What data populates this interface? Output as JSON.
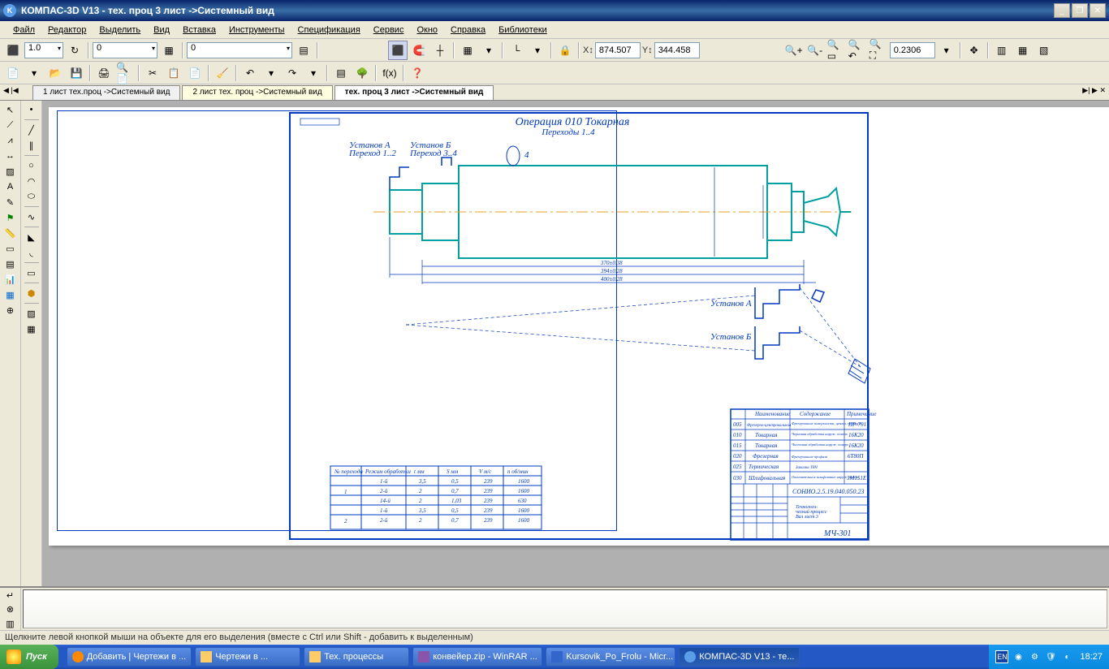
{
  "app": {
    "title": "КОМПАС-3D V13 - тех. проц 3 лист ->Системный вид"
  },
  "menu": {
    "file": "Файл",
    "edit": "Редактор",
    "select": "Выделить",
    "view": "Вид",
    "insert": "Вставка",
    "tools": "Инструменты",
    "spec": "Спецификация",
    "service": "Сервис",
    "window": "Окно",
    "help": "Справка",
    "lib": "Библиотеки"
  },
  "toolbar1": {
    "combo1": "1.0",
    "combo2": "0",
    "combo3": "0",
    "x": "874.507",
    "y": "344.458",
    "zoom": "0.2306"
  },
  "tabs": {
    "t1": "1 лист тех.проц ->Системный вид",
    "t2": "2 лист тех. проц ->Системный вид",
    "t3": "тех. проц 3 лист ->Системный вид"
  },
  "drawing": {
    "title": "Операция 010 Токарная",
    "subtitle": "Переходы 1..4",
    "ustanov_a": "Установ А",
    "perehod12": "Переход 1..2",
    "ustanov_b": "Установ Б",
    "perehod34": "Переход 3..4",
    "ustanov_a2": "Установ А",
    "ustanov_b2": "Установ Б",
    "dim4": "4"
  },
  "table": {
    "headers": [
      "№ перехода",
      "Режим обработки",
      "t мм",
      "S мм",
      "V м/с",
      "n об/мин"
    ],
    "rows": [
      [
        "",
        "1-й",
        "3,5",
        "0,5",
        "239",
        "1600"
      ],
      [
        "1",
        "2-й",
        "2",
        "0,7",
        "239",
        "1600"
      ],
      [
        "",
        "14-й",
        "2",
        "1,03",
        "239",
        "630"
      ],
      [
        "2",
        "1-й",
        "3,5",
        "0,5",
        "239",
        "1600"
      ],
      [
        "",
        "2-й",
        "2",
        "0,7",
        "239",
        "1600"
      ]
    ]
  },
  "stamp": {
    "cols": [
      "Наименование",
      "Содержание",
      "Примечание"
    ],
    "rows": [
      [
        "005",
        "Фрезерно-центровальная",
        "Фрезерование поверхности, центр. отверст.",
        "ПР-791"
      ],
      [
        "010",
        "Токарная",
        "Черновая обработка наруж. поверх",
        "16К20"
      ],
      [
        "015",
        "Токарная",
        "Чистовая обработка наруж. поверх",
        "16К20"
      ],
      [
        "020",
        "Фрезерная",
        "Фрезерование профиля",
        "6Т80П"
      ],
      [
        "025",
        "Термическая",
        "Закалка ТВЧ",
        ""
      ],
      [
        "030",
        "Шлифовальная",
        "Окончательное шлифование наруж. поверх",
        "3М151Е"
      ]
    ],
    "code": "СОНИО.2.5.19.040.050.23",
    "desc": "Технологи-\nческий процесс\nВал-лист 3",
    "group": "МЧ-301"
  },
  "statusbar": {
    "text": "Щелкните левой кнопкой мыши на объекте для его выделения (вместе с Ctrl или Shift - добавить к выделенным)"
  },
  "taskbar": {
    "start": "Пуск",
    "t1": "Добавить | Чертежи в ...",
    "t2": "Чертежи в ...",
    "t3": "Тех. процессы",
    "t4": "конвейер.zip - WinRAR ...",
    "t5": "Kursovik_Po_Frolu - Micr...",
    "t6": "КОМПАС-3D V13 - те...",
    "lang": "EN",
    "time": "18:27"
  }
}
